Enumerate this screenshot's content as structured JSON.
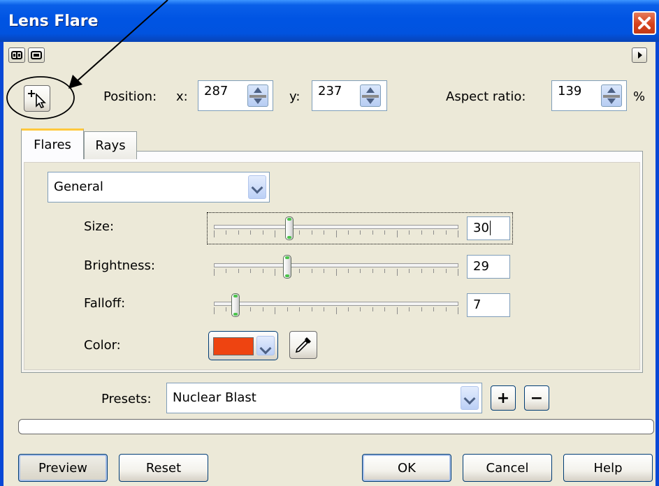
{
  "window": {
    "title": "Lens Flare"
  },
  "position": {
    "label": "Position:",
    "x_label": "x:",
    "x_value": "287",
    "y_label": "y:",
    "y_value": "237",
    "aspect_label": "Aspect ratio:",
    "aspect_value": "139",
    "aspect_unit": "%"
  },
  "tabs": [
    {
      "label": "Flares",
      "active": true
    },
    {
      "label": "Rays",
      "active": false
    }
  ],
  "flares": {
    "mode": "General",
    "size": {
      "label": "Size:",
      "value": "30",
      "max": 100
    },
    "brightness": {
      "label": "Brightness:",
      "value": "29",
      "max": 100
    },
    "falloff": {
      "label": "Falloff:",
      "value": "7",
      "max": 100
    },
    "color": {
      "label": "Color:",
      "swatch": "#ee4411"
    }
  },
  "presets": {
    "label": "Presets:",
    "value": "Nuclear Blast"
  },
  "buttons": {
    "preview": "Preview",
    "reset": "Reset",
    "ok": "OK",
    "cancel": "Cancel",
    "help": "Help",
    "add": "+",
    "remove": "−"
  },
  "theme": {
    "titlebar": "#0054e3",
    "dialog_bg": "#ece9d8",
    "tab_highlight": "#ffc83c",
    "annotation": "#000000"
  }
}
